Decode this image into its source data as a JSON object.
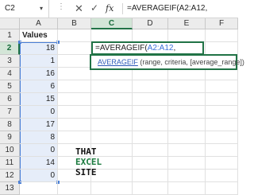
{
  "name_box": {
    "value": "C2"
  },
  "formula_bar": {
    "cancel_icon": "✕",
    "enter_icon": "✓",
    "fx_label": "fx",
    "content": "=AVERAGEIF(A2:A12,"
  },
  "columns": [
    "A",
    "B",
    "C",
    "D",
    "E",
    "F"
  ],
  "rows": [
    "1",
    "2",
    "3",
    "4",
    "5",
    "6",
    "7",
    "8",
    "9",
    "10",
    "11",
    "12",
    "13"
  ],
  "column_a": {
    "header": "Values",
    "values": [
      "18",
      "1",
      "16",
      "6",
      "15",
      "0",
      "17",
      "8",
      "0",
      "14",
      "0"
    ]
  },
  "edit_cell": {
    "fn_text": "=AVERAGEIF(",
    "ref_text": "A2:A12",
    "tail_text": ","
  },
  "tooltip": {
    "fn_name": "AVERAGEIF",
    "args": " (range, criteria, [average_range])"
  },
  "logo": {
    "line1": "THAT",
    "line2": "EXCEL",
    "line3": "SITE"
  },
  "colors": {
    "excel_green": "#217346",
    "range_blue": "#4a7fd6"
  }
}
